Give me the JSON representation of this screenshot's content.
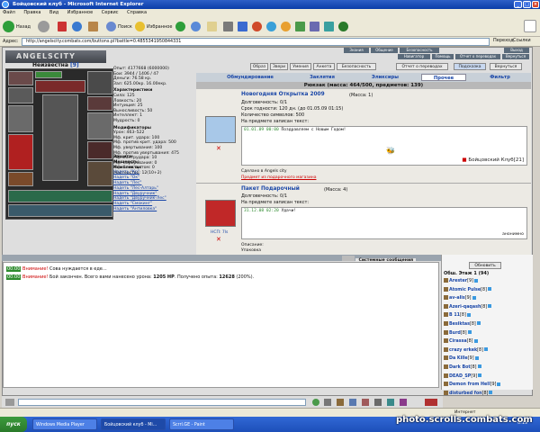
{
  "window": {
    "title": "Бойцовский клуб - Microsoft Internet Explorer"
  },
  "menu": [
    "Файл",
    "Правка",
    "Вид",
    "Избранное",
    "Сервис",
    "Справка"
  ],
  "toolbar": {
    "back": "Назад",
    "search": "Поиск",
    "favorites": "Избранное"
  },
  "address": {
    "label": "Адрес:",
    "url": "http://angelscity.combats.com/buttons.pl?battle=0.4855341950844331",
    "go": "Переход",
    "links": "Ссылки"
  },
  "game": {
    "logo": "ANGELSCITY",
    "topnav": [
      "Знания",
      "Общение",
      "Безопасность",
      "Выход",
      "Навигатор",
      "Помощь",
      "Отчет о переводах",
      "Вернуться"
    ],
    "character": {
      "name": "Неизвестна",
      "level": "[9]"
    },
    "stats": {
      "lines": [
        "Опыт: 4177668 (6000000)",
        "Бои: 3944 / 1406 / 47",
        "Деньги: 76.58 кр.",
        "Зал: 625.00кр. 16.00екр."
      ],
      "char_header": "Характеристики",
      "char_lines": [
        "Сила: 125",
        "Ловкость: 20",
        "Интуиция: 25",
        "Выносливость: 50",
        "Интеллект: 1",
        "Мудрость: 0"
      ],
      "mod_header": "Модификаторы",
      "mod_lines": [
        "Урон: 463–522",
        "Мф. крит. удара: 100",
        "Мф. против крит. удара: 500",
        "Мф. увертывания: 100",
        "Мф. против увертывания: 475",
        "Мф. контрудара: 10",
        "Мф. парирования: 0",
        "Мф. блок щитом: 0",
        "Мастерство: 12(10+2)"
      ]
    },
    "buttons": [
      "Образ",
      "Звери",
      "Умения",
      "Анкета",
      "Безопасность",
      "Отчет о переводах",
      "Подсказка",
      "Вернуться"
    ],
    "tabs": [
      "Обмундирование",
      "Заклятия",
      "Эликсиры",
      "Прочее",
      "Фильтр"
    ],
    "bag_title": "Рюкзак (масса: 464/500, предметов: 139)",
    "items": [
      {
        "name": "Новогодняя Открытка 2009",
        "mass": "(Масса: 1)",
        "lines": [
          "Долговечность: 0/1",
          "Срок годности: 120 дн. (до 01.05.09 01:15)",
          "Количество символов: 500",
          "На предмете записан текст:"
        ],
        "msg_time": "01.01.09 00:00",
        "msg_text": "Поздравляем с Новым Годом!",
        "signature": "Бойцовский Клуб",
        "sig_level": "[21]",
        "made": "Сделано в Angels city",
        "gift": "Предмет из подарочного магазина"
      },
      {
        "name": "Пакет Подарочный",
        "mass": "(Масса: 4)",
        "lines": [
          "Долговечность: 0/1",
          "На предмете записан текст:"
        ],
        "msg_time": "31.12.08 02:20",
        "msg_text": "Удачи!",
        "signature": "анонимно",
        "desc_label": "Описание:",
        "desc_text": "Упаковка",
        "pic_label": "НСП: 7ls"
      }
    ],
    "sections": [
      "Защита:",
      "Мощность:",
      "Комплекты:"
    ],
    "sets": [
      "Надеть \"Кр\"",
      "Надеть \"Ок\"",
      "Надеть \"Лес\"",
      "Надеть \"Лес-Алтарь\"",
      "Надеть \"Двуручник\"",
      "Надеть \"Двуручник-Лес\"",
      "Надеть \"Смокинг\"",
      "Надеть \"Антиловка\""
    ]
  },
  "chat": {
    "tabs": [
      "Системные сообщения"
    ],
    "messages": [
      {
        "time": "00:00",
        "who": "Внимание!",
        "text": "Сова нуждается в еде..."
      },
      {
        "time": "00:00",
        "who": "Внимание!",
        "text": "Бой закончен. Всего вами нанесено урона:",
        "v1": "1205 HP",
        "t2": ". Получено опыта:",
        "v2": "12628",
        "t3": " (200%)."
      }
    ]
  },
  "online": {
    "refresh": "Обновить",
    "header": "Обш. Этаж 1 (94)",
    "users": [
      {
        "name": "Arester",
        "lvl": "[9]"
      },
      {
        "name": "Atomic Pulse",
        "lvl": "[8]"
      },
      {
        "name": "av-alis",
        "lvl": "[9]"
      },
      {
        "name": "Azeri-qaqash",
        "lvl": "[8]"
      },
      {
        "name": "B 11",
        "lvl": "[8]"
      },
      {
        "name": "Besiktas",
        "lvl": "[8]"
      },
      {
        "name": "Burd",
        "lvl": "[8]"
      },
      {
        "name": "Cirassa",
        "lvl": "[8]"
      },
      {
        "name": "crazy erkek",
        "lvl": "[8]"
      },
      {
        "name": "Da Kille",
        "lvl": "[9]"
      },
      {
        "name": "Dark Bot",
        "lvl": "[8]"
      },
      {
        "name": "DEAD_SP",
        "lvl": "[9]"
      },
      {
        "name": "Demon from Hell",
        "lvl": "[9]"
      },
      {
        "name": "disturbed fon",
        "lvl": "[8]"
      }
    ]
  },
  "status": {
    "zone": "Интернет"
  },
  "taskbar": {
    "start": "пуск",
    "tasks": [
      "Windows Media Player",
      "Бойцовский клуб - Mi...",
      "Scrrl.GE - Paint"
    ],
    "clock": "0:19"
  },
  "watermark": "photo.scrolls.combats.com"
}
